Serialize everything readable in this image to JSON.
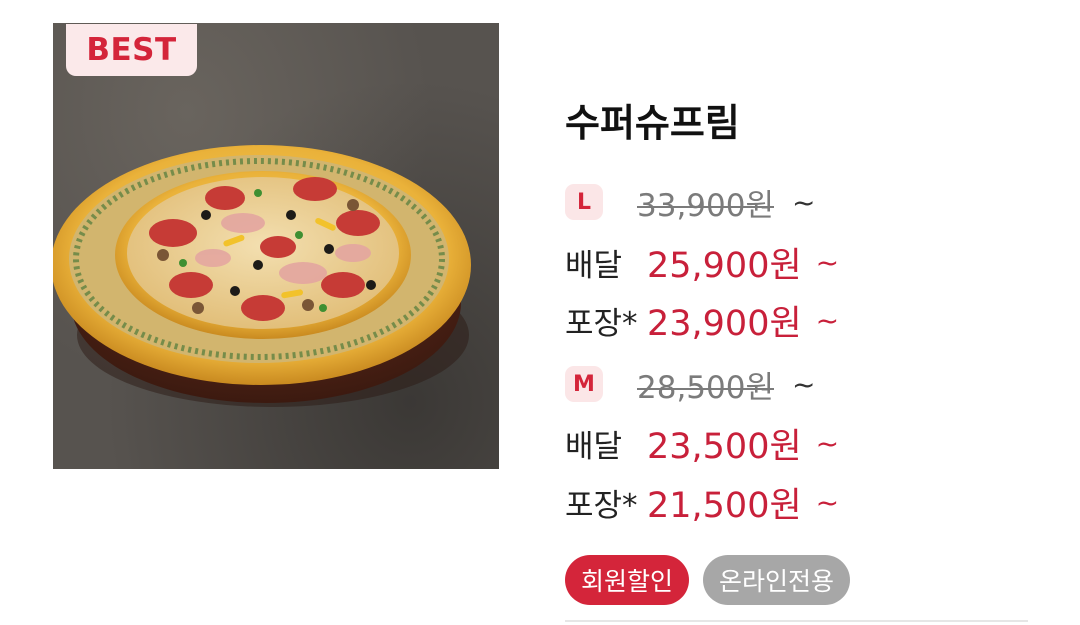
{
  "product": {
    "badge": "BEST",
    "name": "수퍼슈프림",
    "image_alt": "pizza-photo",
    "sizes": [
      {
        "size": "L",
        "original_price": "33,900원",
        "original_suffix": "~",
        "delivery_label": "배달",
        "delivery_price": "25,900원",
        "delivery_suffix": "~",
        "pickup_label": "포장*",
        "pickup_price": "23,900원",
        "pickup_suffix": "~"
      },
      {
        "size": "M",
        "original_price": "28,500원",
        "original_suffix": "~",
        "delivery_label": "배달",
        "delivery_price": "23,500원",
        "delivery_suffix": "~",
        "pickup_label": "포장*",
        "pickup_price": "21,500원",
        "pickup_suffix": "~"
      }
    ],
    "tags": [
      "회원할인",
      "온라인전용"
    ]
  },
  "colors": {
    "accent": "#d4253a",
    "price_red": "#c8203a",
    "badge_bg": "#fbe9ea",
    "tag_gray": "#a7a7a7",
    "strike_gray": "#7b7b7b"
  }
}
